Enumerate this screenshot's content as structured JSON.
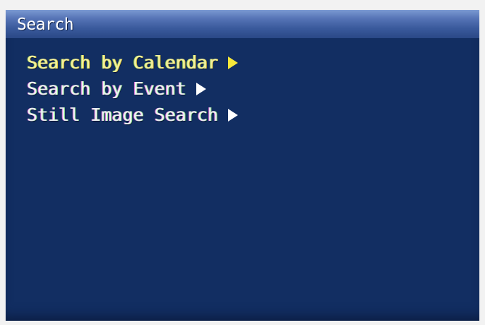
{
  "window": {
    "title": "Search"
  },
  "menu": {
    "items": [
      {
        "label": "Search by Calendar",
        "selected": true
      },
      {
        "label": "Search by Event",
        "selected": false
      },
      {
        "label": "Still Image Search",
        "selected": false
      }
    ]
  },
  "colors": {
    "background": "#122e62",
    "selected_text": "#f3f0a0",
    "selected_arrow": "#f7e83a",
    "text": "#eef1f4"
  },
  "icons": {
    "submenu_arrow": "right-triangle-icon"
  }
}
